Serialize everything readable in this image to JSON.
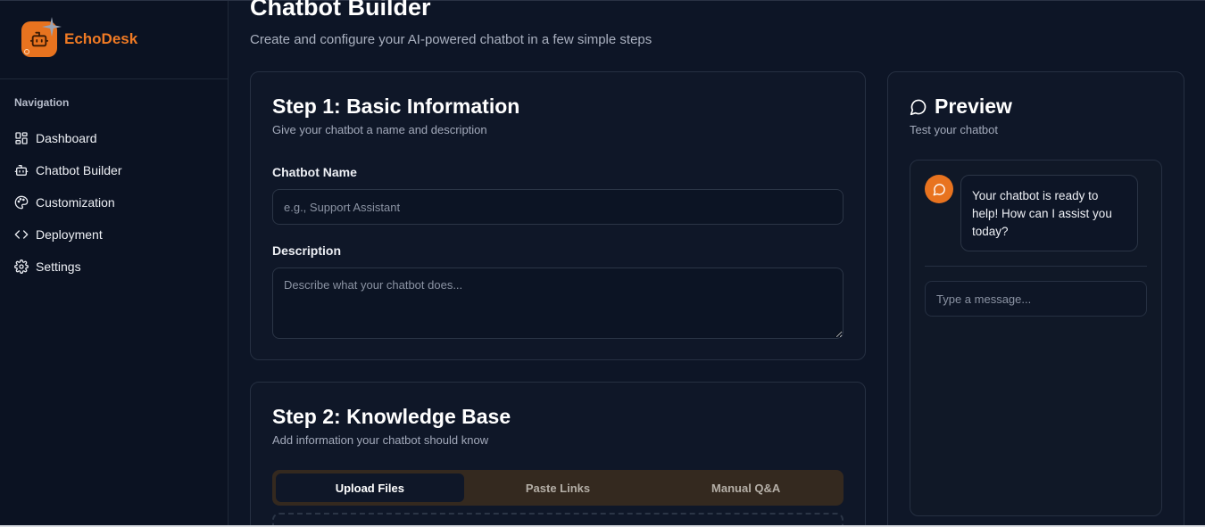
{
  "brand": {
    "name": "EchoDesk",
    "logo_icon": "robot-icon",
    "accent_color": "#e8731f"
  },
  "sidebar": {
    "section_title": "Navigation",
    "items": [
      {
        "label": "Dashboard",
        "icon": "dashboard-icon"
      },
      {
        "label": "Chatbot Builder",
        "icon": "robot-icon"
      },
      {
        "label": "Customization",
        "icon": "palette-icon"
      },
      {
        "label": "Deployment",
        "icon": "code-icon"
      },
      {
        "label": "Settings",
        "icon": "gear-icon"
      }
    ]
  },
  "header": {
    "title": "Chatbot Builder",
    "subtitle": "Create and configure your AI-powered chatbot in a few simple steps"
  },
  "step1": {
    "title": "Step 1: Basic Information",
    "subtitle": "Give your chatbot a name and description",
    "name_label": "Chatbot Name",
    "name_placeholder": "e.g., Support Assistant",
    "description_label": "Description",
    "description_placeholder": "Describe what your chatbot does..."
  },
  "step2": {
    "title": "Step 2: Knowledge Base",
    "subtitle": "Add information your chatbot should know",
    "tabs": [
      {
        "label": "Upload Files",
        "active": true
      },
      {
        "label": "Paste Links",
        "active": false
      },
      {
        "label": "Manual Q&A",
        "active": false
      }
    ]
  },
  "preview": {
    "title": "Preview",
    "subtitle": "Test your chatbot",
    "bot_message": "Your chatbot is ready to help! How can I assist you today?",
    "input_placeholder": "Type a message..."
  }
}
